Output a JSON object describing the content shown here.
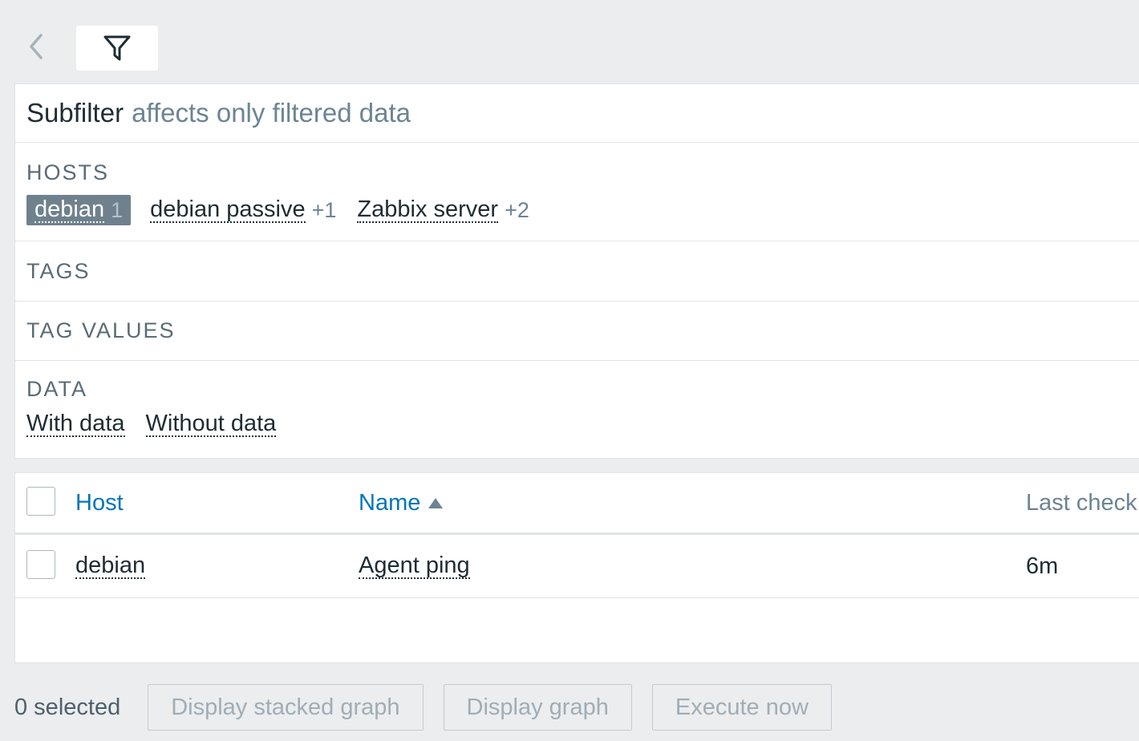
{
  "subfilter": {
    "title": "Subfilter",
    "note": "affects only filtered data",
    "hosts": {
      "label": "HOSTS",
      "items": [
        {
          "name": "debian",
          "count": "1",
          "selected": true
        },
        {
          "name": "debian passive",
          "count": "+1",
          "selected": false
        },
        {
          "name": "Zabbix server",
          "count": "+2",
          "selected": false
        }
      ]
    },
    "tags": {
      "label": "TAGS"
    },
    "tag_values": {
      "label": "TAG VALUES"
    },
    "data": {
      "label": "DATA",
      "items": [
        {
          "name": "With data"
        },
        {
          "name": "Without data"
        }
      ]
    }
  },
  "table": {
    "headers": {
      "host": "Host",
      "name": "Name",
      "last_check": "Last check"
    },
    "rows": [
      {
        "host": "debian",
        "name": "Agent ping",
        "last_check": "6m"
      }
    ]
  },
  "footer": {
    "selected": "0 selected",
    "buttons": {
      "stacked": "Display stacked graph",
      "graph": "Display graph",
      "execute": "Execute now"
    }
  },
  "colors": {
    "link": "#0275b8",
    "muted": "#6c8494",
    "chip_selected_bg": "#6f818d"
  },
  "icons": {
    "back": "chevron-left-icon",
    "filter": "funnel-icon"
  }
}
